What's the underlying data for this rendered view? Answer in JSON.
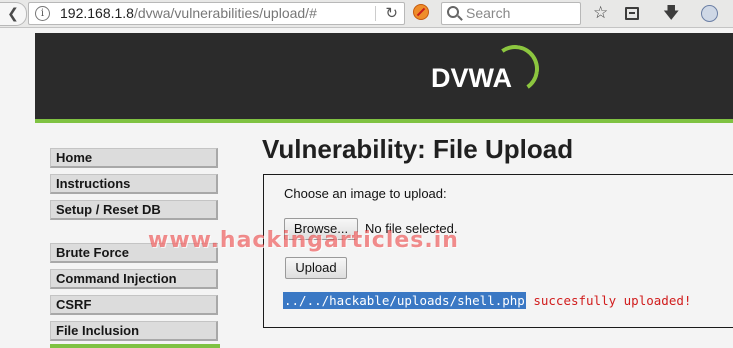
{
  "browser": {
    "url_host": "192.168.1.8",
    "url_path": "/dvwa/vulnerabilities/upload/#",
    "search_placeholder": "Search",
    "icons": [
      "back-arrow-icon",
      "info-icon",
      "reload-icon",
      "noscript-icon",
      "search-icon",
      "star-icon",
      "reader-icon",
      "download-icon",
      "dvwa-extension-icon"
    ]
  },
  "header": {
    "logo_text": "DVWA",
    "brand_green": "#7fc242"
  },
  "sidebar": {
    "group1": [
      "Home",
      "Instructions",
      "Setup / Reset DB"
    ],
    "group2": [
      "Brute Force",
      "Command Injection",
      "CSRF",
      "File Inclusion"
    ]
  },
  "main": {
    "title": "Vulnerability: File Upload",
    "choose_label": "Choose an image to upload:",
    "browse_label": "Browse...",
    "no_file_text": "No file selected.",
    "upload_label": "Upload",
    "result_path": "../../hackable/uploads/shell.php",
    "result_message": " succesfully uploaded!",
    "result_color": "#d11c1c"
  },
  "watermark": "www.hackingarticles.in"
}
